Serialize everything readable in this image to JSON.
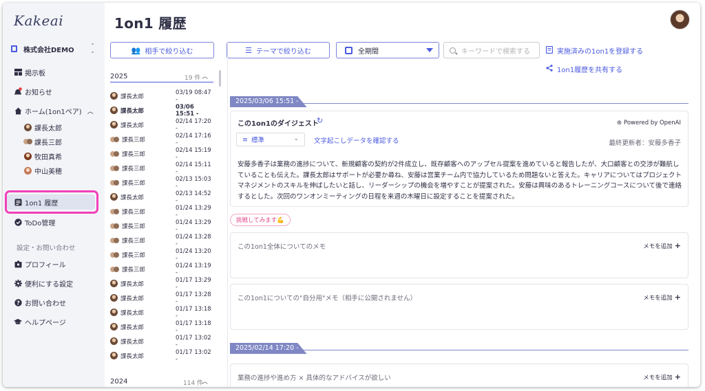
{
  "app": {
    "logo": "Kakeai",
    "page_title": "1on1 履歴"
  },
  "sidebar": {
    "org": "株式会社DEMO",
    "items": [
      {
        "label": "掲示板"
      },
      {
        "label": "お知らせ"
      },
      {
        "label": "ホーム(1on1ペア)"
      },
      {
        "label": "課長太郎"
      },
      {
        "label": "課長三郎"
      },
      {
        "label": "牧田真希"
      },
      {
        "label": "中山美穂"
      },
      {
        "label": "1on1 履歴"
      },
      {
        "label": "ToDo管理"
      }
    ],
    "section_label": "設定・お問い合わせ",
    "settings": [
      {
        "label": "プロフィール"
      },
      {
        "label": "便利にする設定"
      },
      {
        "label": "お問い合わせ"
      },
      {
        "label": "ヘルプページ"
      }
    ]
  },
  "toolbar": {
    "filter_partner": "相手で絞り込む",
    "filter_theme": "テーマで絞り込む",
    "period": "全期間",
    "search_placeholder": "キーワードで検索する",
    "register_link": "実施済みの1on1を登録する",
    "share_link": "1on1履歴を共有する"
  },
  "history": {
    "year1": {
      "label": "2025",
      "count": "19 件"
    },
    "year2": {
      "label": "2024",
      "count": "114 件"
    },
    "rows": [
      {
        "name": "課長太郎",
        "date": "03/19 08:47 -"
      },
      {
        "name": "課長太郎",
        "date": "03/06 15:51 -"
      },
      {
        "name": "課長太郎",
        "date": "02/14 17:20 -"
      },
      {
        "name": "課長三郎",
        "date": "02/14 17:16 -"
      },
      {
        "name": "課長三郎",
        "date": "02/14 15:19 -"
      },
      {
        "name": "課長三郎",
        "date": "02/14 15:11 -"
      },
      {
        "name": "課長三郎",
        "date": "02/13 15:03 -"
      },
      {
        "name": "課長太郎",
        "date": "02/13 14:52 -"
      },
      {
        "name": "課長三郎",
        "date": "01/24 13:29 -"
      },
      {
        "name": "課長三郎",
        "date": "01/24 13:29 -"
      },
      {
        "name": "課長三郎",
        "date": "01/24 13:28 -"
      },
      {
        "name": "課長三郎",
        "date": "01/24 13:20 -"
      },
      {
        "name": "課長三郎",
        "date": "01/24 13:19 -"
      },
      {
        "name": "課長太郎",
        "date": "01/17 13:29 -"
      },
      {
        "name": "課長太郎",
        "date": "01/17 13:28 -"
      },
      {
        "name": "課長太郎",
        "date": "01/17 13:18 -"
      },
      {
        "name": "課長太郎",
        "date": "01/17 13:18 -"
      },
      {
        "name": "課長太郎",
        "date": "01/17 13:02 -"
      },
      {
        "name": "課長太郎",
        "date": "01/17 13:02 -"
      }
    ]
  },
  "session1": {
    "timestamp": "2025/03/06 15:51 -",
    "digest_title": "この1on1のダイジェスト",
    "powered_by": "Powered by OpenAI",
    "style_select": "標準",
    "transcript_link": "文字起こしデータを確認する",
    "updated": "最終更新者：安藤多香子",
    "digest_body": "安藤多香子は業務の進捗について、新規顧客の契約が2件成立し、既存顧客へのアップセル提案を進めていると報告したが、大口顧客との交渉が難航していることも伝えた。課長太郎はサポートが必要か尋ね、安藤は営業チーム内で協力しているため問題ないと答えた。キャリアについてはプロジェクトマネジメントのスキルを伸ばしたいと話し、リーダーシップの機会を増やすことが提案された。安藤は興味のあるトレーニングコースについて後で連絡するとした。次回のワンオンミーティングの日程を来週の木曜日に設定することを提案された。",
    "chip": "挑戦してみます💪",
    "memo_all": "この1on1全体についてのメモ",
    "memo_self": "この1on1についての\"自分用\"メモ（相手に公開されません）",
    "memo_add": "メモを追加"
  },
  "session2": {
    "timestamp": "2025/02/14 17:20 -",
    "theme": "業務の進捗や進め方 × 具体的なアドバイスが欲しい",
    "memo_add": "メモを追加"
  }
}
